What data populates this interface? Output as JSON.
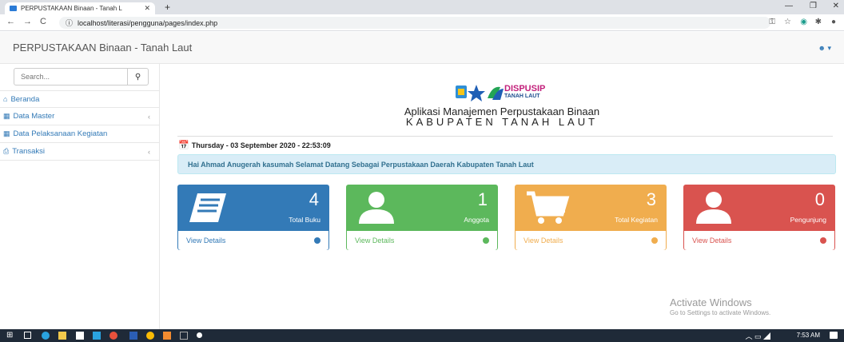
{
  "browser": {
    "tab_title": "PERPUSTAKAAN Binaan - Tanah L",
    "url": "localhost/literasi/pengguna/pages/index.php"
  },
  "header": {
    "brand": "PERPUSTAKAAN Binaan - Tanah Laut"
  },
  "sidebar": {
    "search_placeholder": "Search...",
    "items": [
      {
        "label": "Beranda",
        "icon": "home-icon"
      },
      {
        "label": "Data Master",
        "icon": "table-icon",
        "has_submenu": true
      },
      {
        "label": "Data Pelaksanaan Kegiatan",
        "icon": "table-icon"
      },
      {
        "label": "Transaksi",
        "icon": "print-icon",
        "has_submenu": true
      }
    ]
  },
  "main": {
    "logo_text": "DISPUSIP",
    "logo_subtext": "TANAH LAUT",
    "title": "Aplikasi Manajemen Perpustakaan Binaan",
    "subtitle": "KABUPATEN TANAH LAUT",
    "date": "Thursday - 03 September 2020 - 22:53:09",
    "welcome": "Hai Ahmad Anugerah kasumah Selamat Datang Sebagai Perpustakaan Daerah Kabupaten Tanah Laut",
    "panels": [
      {
        "count": "4",
        "label": "Total Buku",
        "link": "View Details",
        "color": "#337ab7",
        "icon": "book-icon"
      },
      {
        "count": "1",
        "label": "Anggota",
        "link": "View Details",
        "color": "#5cb85c",
        "icon": "user-icon"
      },
      {
        "count": "3",
        "label": "Total Kegiatan",
        "link": "View Details",
        "color": "#f0ad4e",
        "icon": "cart-icon"
      },
      {
        "count": "0",
        "label": "Pengunjung",
        "link": "View Details",
        "color": "#d9534f",
        "icon": "user-icon"
      }
    ]
  },
  "watermark": {
    "line1": "Activate Windows",
    "line2": "Go to Settings to activate Windows."
  },
  "taskbar": {
    "time": "7:53 AM"
  }
}
